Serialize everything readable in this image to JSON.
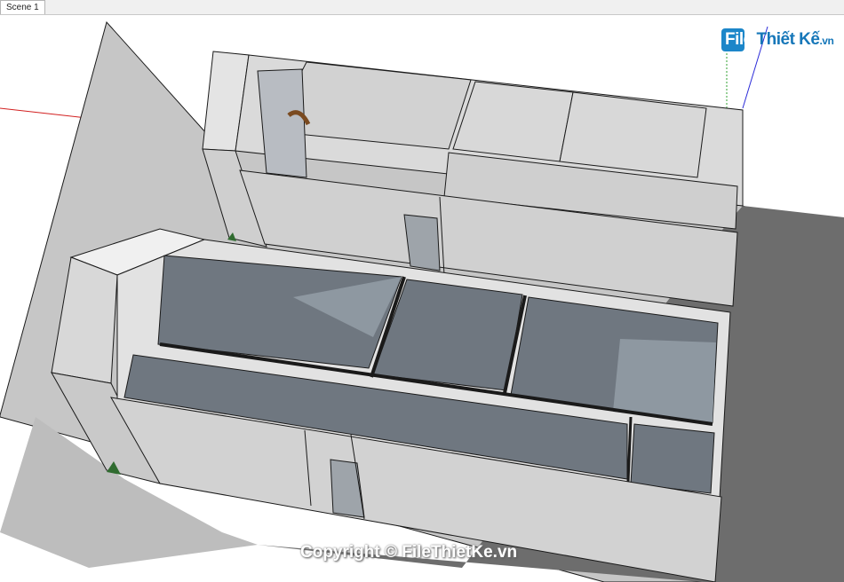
{
  "tabs": [
    {
      "label": "Scene 1"
    }
  ],
  "logo": {
    "text_file": "File",
    "text_main": " Thiết Kế",
    "text_domain": ".vn"
  },
  "watermark": {
    "text": "Copyright © FileThietKe.vn"
  },
  "colors": {
    "ground": "#c8c8c8",
    "shadow": "#6e6e6e",
    "wall_light": "#d6d6d6",
    "wall_top": "#e6e6e6",
    "floor": "#6f7780",
    "floor_light": "#8e98a1",
    "edge": "#1a1a1a",
    "axis_red": "#d22020",
    "axis_blue": "#2a2ad8",
    "axis_green": "#30a030",
    "logo_blue": "#1677b9"
  }
}
